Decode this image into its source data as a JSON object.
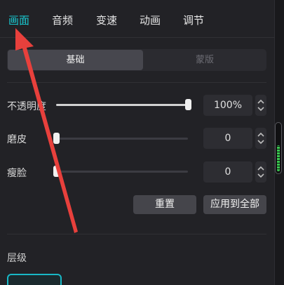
{
  "tabs": [
    {
      "label": "画面",
      "active": true
    },
    {
      "label": "音频",
      "active": false
    },
    {
      "label": "变速",
      "active": false
    },
    {
      "label": "动画",
      "active": false
    },
    {
      "label": "调节",
      "active": false
    }
  ],
  "segment": {
    "basic": "基础",
    "mask": "蒙版"
  },
  "opacity": {
    "label": "不透明度",
    "value": "100%",
    "level": 1.0
  },
  "smooth_skin": {
    "label": "磨皮",
    "value": "0",
    "level": 0.0
  },
  "slim_face": {
    "label": "瘦脸",
    "value": "0",
    "level": 0.0
  },
  "buttons": {
    "reset": "重置",
    "apply_all": "应用到全部"
  },
  "layer": {
    "label": "层级"
  },
  "audio_meter": {
    "level": 0.6
  },
  "colors": {
    "accent": "#18c8d0",
    "annotation_arrow": "#e8403c",
    "meter": "#38c84e"
  },
  "icons": {
    "spinner": "spinner-arrows-icon",
    "annotation": "red-arrow-annotation"
  }
}
